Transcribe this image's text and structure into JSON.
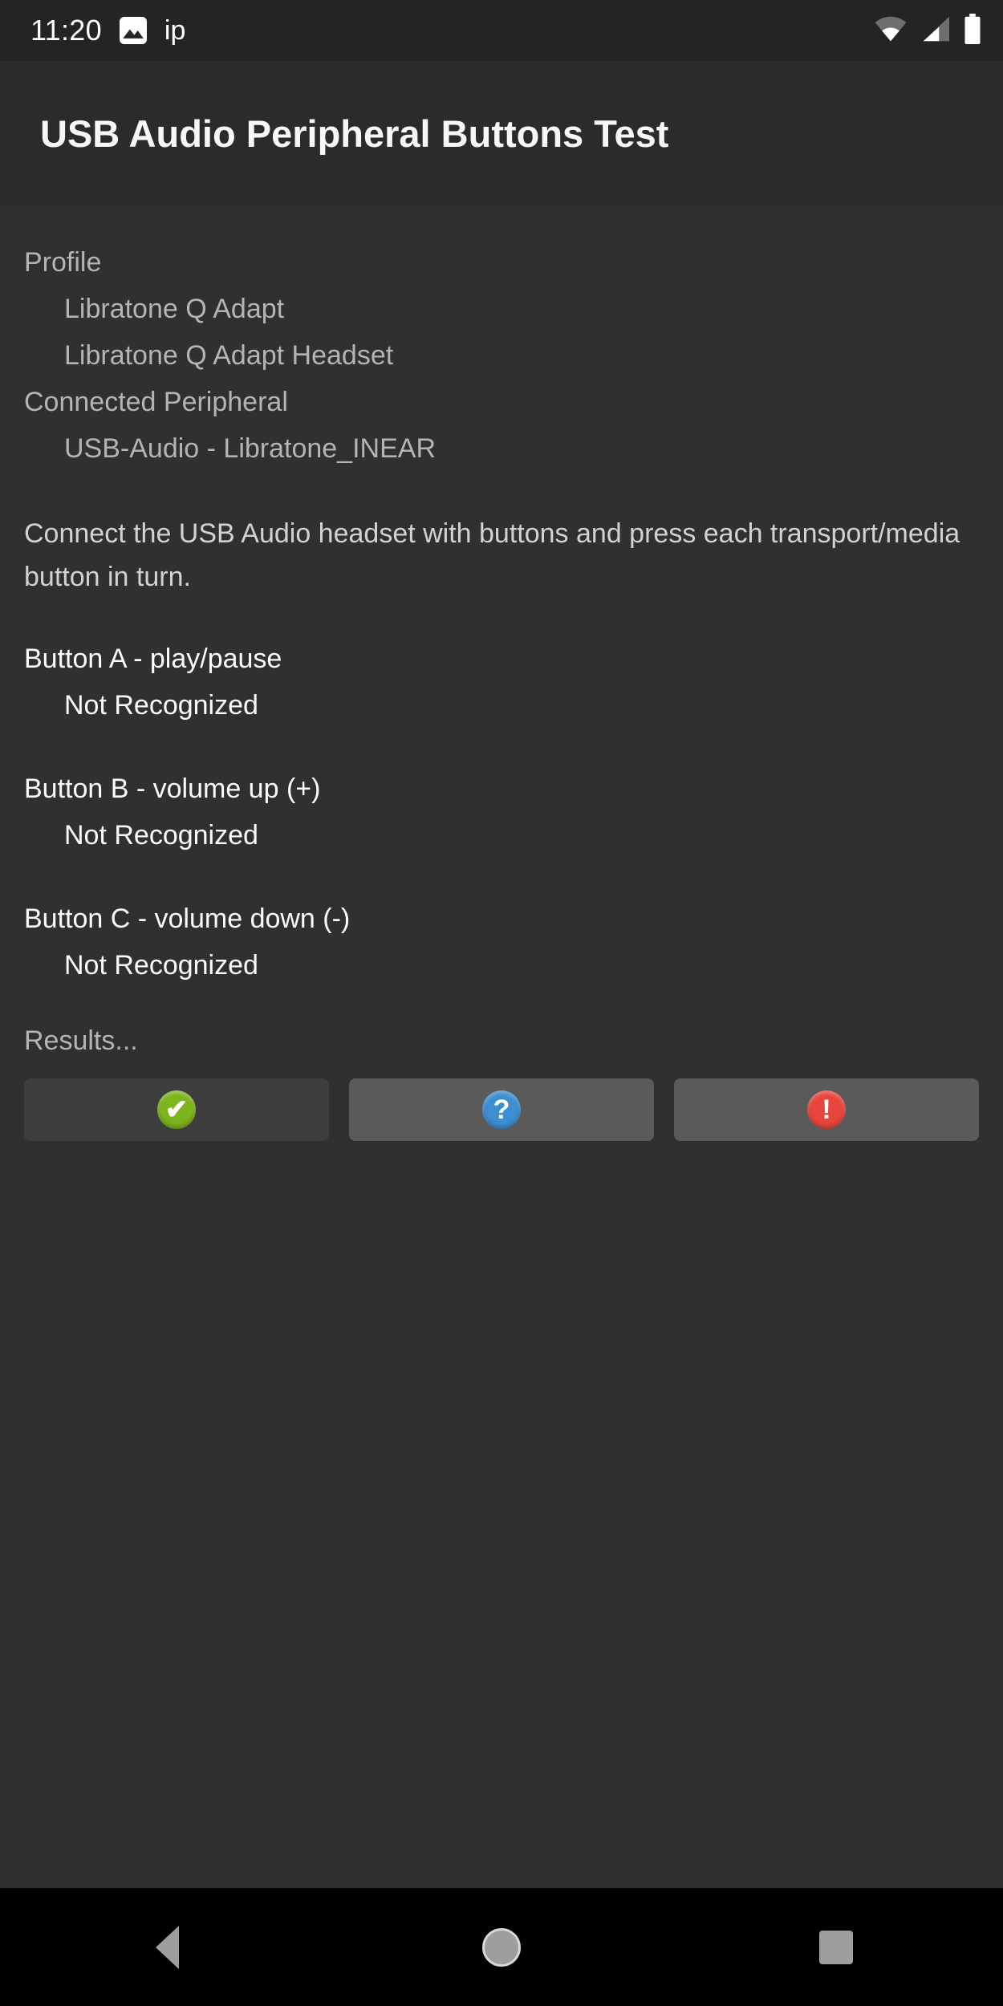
{
  "status_bar": {
    "time": "11:20",
    "notification_icons": [
      "image-icon"
    ],
    "notification_text": "ip",
    "right_icons": [
      "wifi-icon",
      "cell-signal-icon",
      "battery-icon"
    ]
  },
  "app_bar": {
    "title": "USB Audio Peripheral Buttons Test"
  },
  "content": {
    "profile_label": "Profile",
    "profile_values": [
      "Libratone Q Adapt",
      "Libratone Q Adapt Headset"
    ],
    "connected_label": "Connected Peripheral",
    "connected_values": [
      "USB-Audio - Libratone_INEAR"
    ],
    "instructions": "Connect the USB Audio headset with buttons and press each transport/media button in turn.",
    "buttons": [
      {
        "label": "Button A - play/pause",
        "status": "Not Recognized"
      },
      {
        "label": "Button B - volume up (+)",
        "status": "Not Recognized"
      },
      {
        "label": "Button C - volume down (-)",
        "status": "Not Recognized"
      }
    ],
    "results_label": "Results..."
  },
  "result_actions": [
    {
      "name": "pass-button",
      "icon": "check-icon",
      "glyph": "✔",
      "color": "#7db51c",
      "enabled": false
    },
    {
      "name": "info-button",
      "icon": "question-icon",
      "glyph": "?",
      "color": "#3d8fd1",
      "enabled": true
    },
    {
      "name": "fail-button",
      "icon": "exclamation-icon",
      "glyph": "!",
      "color": "#e8463c",
      "enabled": true
    }
  ],
  "navigation_bar": {
    "back_label": "Back",
    "home_label": "Home",
    "recents_label": "Recents"
  },
  "colors": {
    "status_bar_bg": "#242424",
    "app_bar_bg": "#2b2b2b",
    "content_bg": "#303030",
    "nav_bar_bg": "#000000",
    "button_bg": "#5a5a5a",
    "button_disabled_bg": "#3d3d3d",
    "text_primary": "#fbfbfb",
    "text_secondary": "#b4b4b4"
  }
}
